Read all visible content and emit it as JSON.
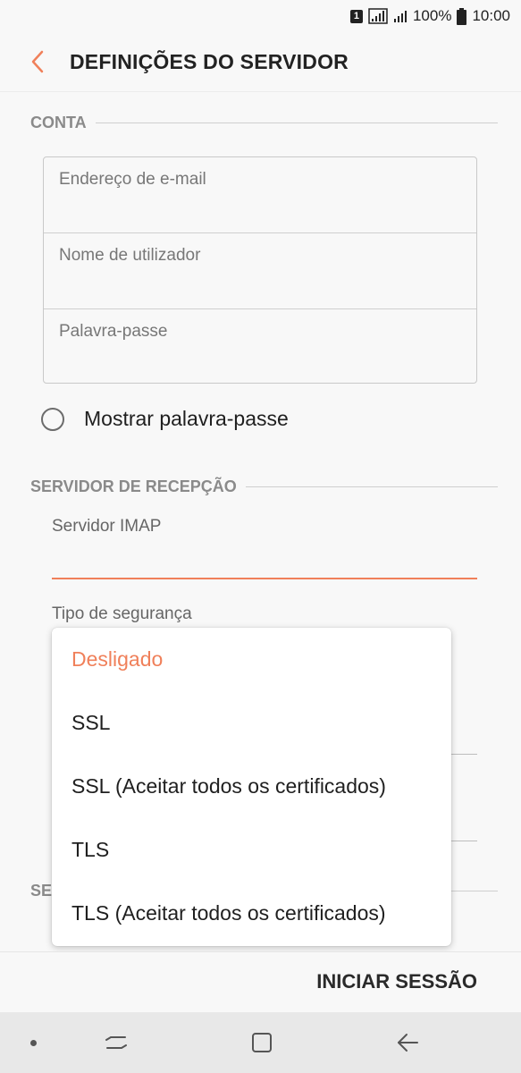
{
  "status_bar": {
    "sim": "1",
    "battery_percent": "100%",
    "time": "10:00"
  },
  "app_bar": {
    "title": "DEFINIÇÕES DO SERVIDOR"
  },
  "account_section": {
    "header": "CONTA",
    "email_placeholder": "Endereço de e-mail",
    "username_placeholder": "Nome de utilizador",
    "password_placeholder": "Palavra-passe",
    "show_password_label": "Mostrar palavra-passe",
    "show_password_checked": false
  },
  "incoming_section": {
    "header": "SERVIDOR DE RECEPÇÃO",
    "imap_label": "Servidor IMAP",
    "imap_value": "",
    "security_label": "Tipo de segurança"
  },
  "partial_section": {
    "header_visible": "SE"
  },
  "security_dropdown": {
    "options": [
      "Desligado",
      "SSL",
      "SSL (Aceitar todos os certificados)",
      "TLS",
      "TLS (Aceitar todos os certificados)"
    ],
    "selected": "Desligado"
  },
  "actions": {
    "sign_in_label": "INICIAR SESSÃO"
  },
  "colors": {
    "accent": "#f0805a",
    "background": "#f8f8f8",
    "nav_bar": "#e8e8e8"
  },
  "icons": {
    "back": "chevron-left-icon",
    "recent": "recent-apps-icon",
    "home": "home-icon",
    "nav_back": "back-arrow-icon"
  }
}
